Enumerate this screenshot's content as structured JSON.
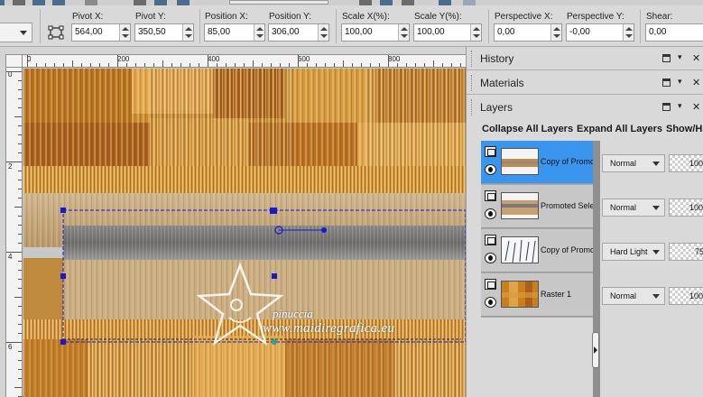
{
  "toolbar": {
    "fields": [
      {
        "id": "pivot-x",
        "label": "Pivot X:",
        "value": "564,00"
      },
      {
        "id": "pivot-y",
        "label": "Pivot Y:",
        "value": "350,50"
      },
      {
        "id": "position-x",
        "label": "Position X:",
        "value": "85,00"
      },
      {
        "id": "position-y",
        "label": "Position Y:",
        "value": "306,00"
      },
      {
        "id": "scale-x",
        "label": "Scale X(%):",
        "value": "100,00"
      },
      {
        "id": "scale-y",
        "label": "Scale Y(%):",
        "value": "100,00"
      },
      {
        "id": "perspective-x",
        "label": "Perspective X:",
        "value": "0,00"
      },
      {
        "id": "perspective-y",
        "label": "Perspective Y:",
        "value": "-0,00"
      },
      {
        "id": "shear",
        "label": "Shear:",
        "value": "0,00"
      }
    ]
  },
  "rulers": {
    "horizontal": [
      "0",
      "200",
      "400",
      "600",
      "800"
    ],
    "vertical": [
      "0",
      "2",
      "4",
      "6"
    ]
  },
  "watermark": {
    "name": "pinuccia",
    "site": "www.maidiregrafica.eu"
  },
  "palettes": {
    "history": "History",
    "materials": "Materials",
    "layers": "Layers"
  },
  "layers_panel": {
    "collapse_all": "Collapse All Layers",
    "expand_all": "Expand All Layers",
    "show_hide": "Show/H",
    "layers": [
      {
        "name": "Copy of Promo",
        "blend": "Normal",
        "opacity": "100",
        "selected": true
      },
      {
        "name": "Promoted Sele",
        "blend": "Normal",
        "opacity": "100",
        "selected": false
      },
      {
        "name": "Copy of Promo",
        "blend": "Hard Light",
        "opacity": "75",
        "selected": false
      },
      {
        "name": "Raster 1",
        "blend": "Normal",
        "opacity": "100",
        "selected": false
      }
    ]
  },
  "colors": {
    "selection_accent": "#3a95ee",
    "handle_blue": "#1a1acc",
    "canvas_orange": "#c8841e"
  }
}
